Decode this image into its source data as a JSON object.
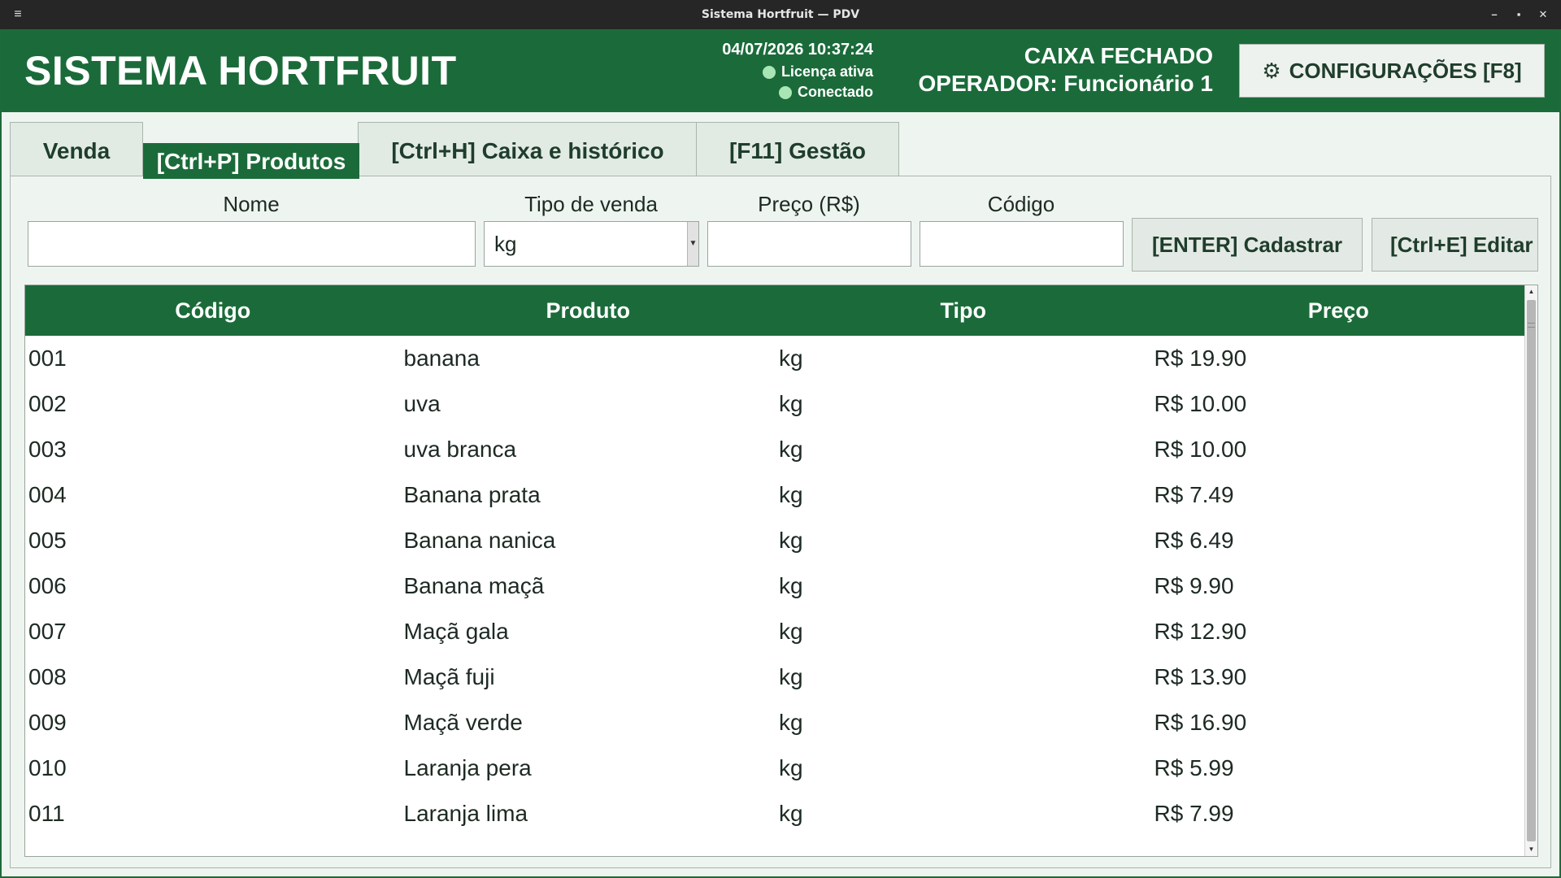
{
  "window": {
    "title": "Sistema Hortfruit — PDV",
    "menu_glyph": "≡",
    "minimize_glyph": "–",
    "maximize_glyph": "▪",
    "close_glyph": "✕"
  },
  "header": {
    "app_title": "SISTEMA HORTFRUIT",
    "datetime": "04/07/2026 10:37:24",
    "license_status": "Licença ativa",
    "connection_status": "Conectado",
    "status_dot_color": "#a8e6b6",
    "cash_status": "CAIXA FECHADO",
    "operator": "OPERADOR: Funcionário 1",
    "config_button": {
      "icon": "⚙",
      "label": "CONFIGURAÇÕES  [F8]"
    }
  },
  "tabs": [
    {
      "label": "Venda",
      "active": false
    },
    {
      "label": "[Ctrl+P] Produtos",
      "active": true
    },
    {
      "label": "[Ctrl+H] Caixa e histórico",
      "active": false
    },
    {
      "label": "[F11] Gestão",
      "active": false
    }
  ],
  "form": {
    "name_label": "Nome",
    "name_value": "",
    "sale_type_label": "Tipo de venda",
    "sale_type_value": "kg",
    "price_label": "Preço (R$)",
    "price_value": "",
    "code_label": "Código",
    "code_value": "",
    "register_button": "[ENTER] Cadastrar",
    "edit_button": "[Ctrl+E] Editar"
  },
  "table": {
    "columns": [
      "Código",
      "Produto",
      "Tipo",
      "Preço"
    ],
    "rows": [
      [
        "001",
        "banana",
        "kg",
        "R$ 19.90"
      ],
      [
        "002",
        "uva",
        "kg",
        "R$ 10.00"
      ],
      [
        "003",
        "uva branca",
        "kg",
        "R$ 10.00"
      ],
      [
        "004",
        "Banana prata",
        "kg",
        "R$ 7.49"
      ],
      [
        "005",
        "Banana nanica",
        "kg",
        "R$ 6.49"
      ],
      [
        "006",
        "Banana maçã",
        "kg",
        "R$ 9.90"
      ],
      [
        "007",
        "Maçã gala",
        "kg",
        "R$ 12.90"
      ],
      [
        "008",
        "Maçã fuji",
        "kg",
        "R$ 13.90"
      ],
      [
        "009",
        "Maçã verde",
        "kg",
        "R$ 16.90"
      ],
      [
        "010",
        "Laranja pera",
        "kg",
        "R$ 5.99"
      ],
      [
        "011",
        "Laranja lima",
        "kg",
        "R$ 7.99"
      ]
    ]
  },
  "colors": {
    "brand_green": "#1b6b3a",
    "background": "#eef5f0"
  }
}
